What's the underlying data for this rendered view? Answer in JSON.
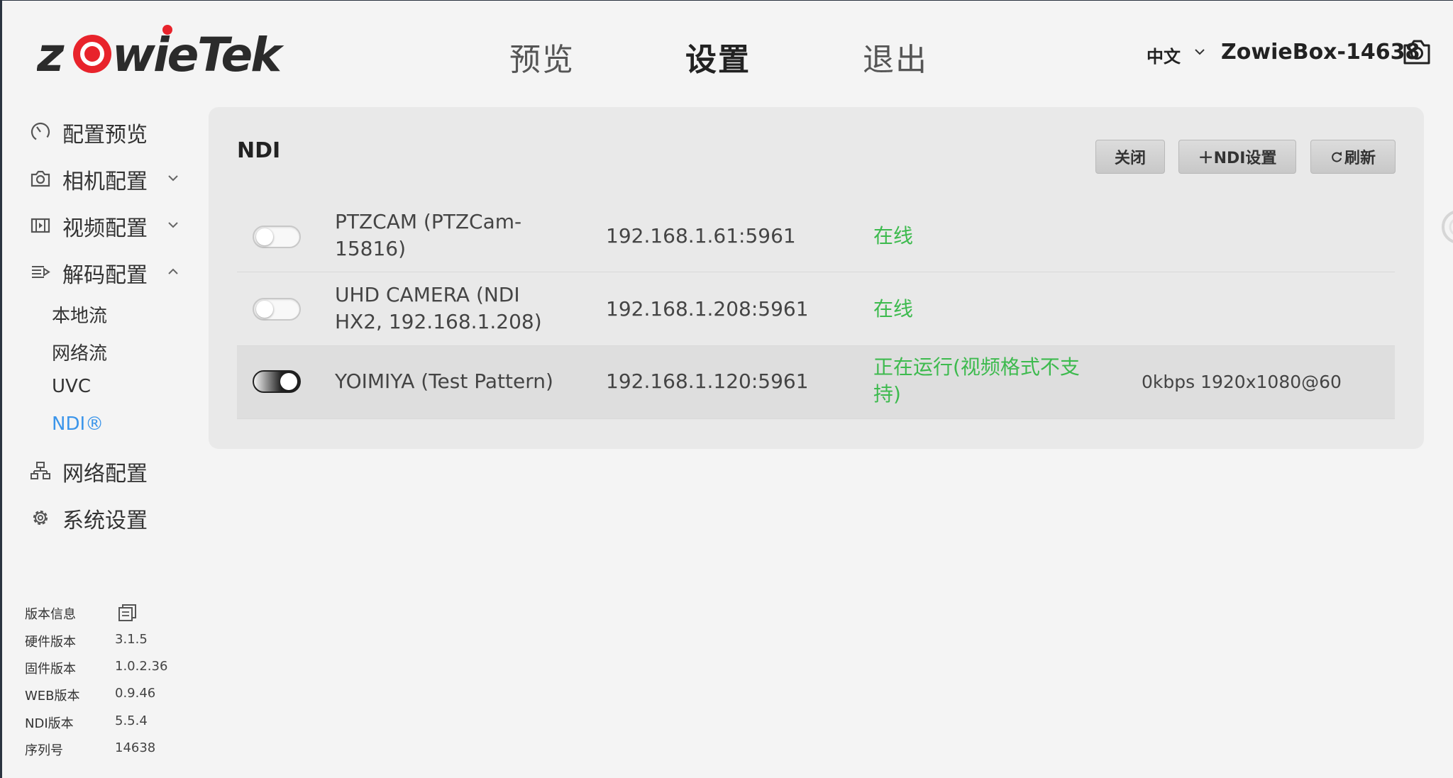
{
  "logo": {
    "text": "zowieTek"
  },
  "nav": {
    "preview": "预览",
    "settings": "设置",
    "logout": "退出"
  },
  "header": {
    "language": "中文",
    "device": "ZowieBox-14638"
  },
  "sidebar": {
    "items": [
      {
        "label": "配置预览",
        "icon": "gauge-icon"
      },
      {
        "label": "相机配置",
        "icon": "camera-icon"
      },
      {
        "label": "视频配置",
        "icon": "film-icon"
      },
      {
        "label": "解码配置",
        "icon": "decode-icon"
      },
      {
        "label": "网络配置",
        "icon": "network-icon"
      },
      {
        "label": "系统设置",
        "icon": "gear-icon"
      }
    ],
    "decode_sub": [
      "本地流",
      "网络流",
      "UVC",
      "NDI®"
    ]
  },
  "version": {
    "title": "版本信息",
    "rows": [
      {
        "k": "硬件版本",
        "v": "3.1.5"
      },
      {
        "k": "固件版本",
        "v": "1.0.2.36"
      },
      {
        "k": "WEB版本",
        "v": "0.9.46"
      },
      {
        "k": "NDI版本",
        "v": "5.5.4"
      },
      {
        "k": "序列号",
        "v": "14638"
      }
    ]
  },
  "panel": {
    "title": "NDI",
    "buttons": {
      "close": "关闭",
      "ndi_settings": "＋NDI设置",
      "refresh": "刷新"
    },
    "rows": [
      {
        "name_line1": "PTZCAM (PTZCam-",
        "name_line2": "15816)",
        "ip": "192.168.1.61:5961",
        "status": "在线",
        "status_line2": "",
        "extra": "",
        "enabled": false
      },
      {
        "name_line1": "UHD CAMERA (NDI",
        "name_line2": "HX2, 192.168.1.208)",
        "ip": "192.168.1.208:5961",
        "status": "在线",
        "status_line2": "",
        "extra": "",
        "enabled": false
      },
      {
        "name_line1": "YOIMIYA (Test Pattern)",
        "name_line2": "",
        "ip": "192.168.1.120:5961",
        "status": "正在运行(视频格式不支",
        "status_line2": "持)",
        "extra": "0kbps 1920x1080@60",
        "enabled": true
      }
    ]
  },
  "colors": {
    "accent": "#3b95ea",
    "online": "#3dba4e",
    "logo_red": "#e8232b"
  }
}
